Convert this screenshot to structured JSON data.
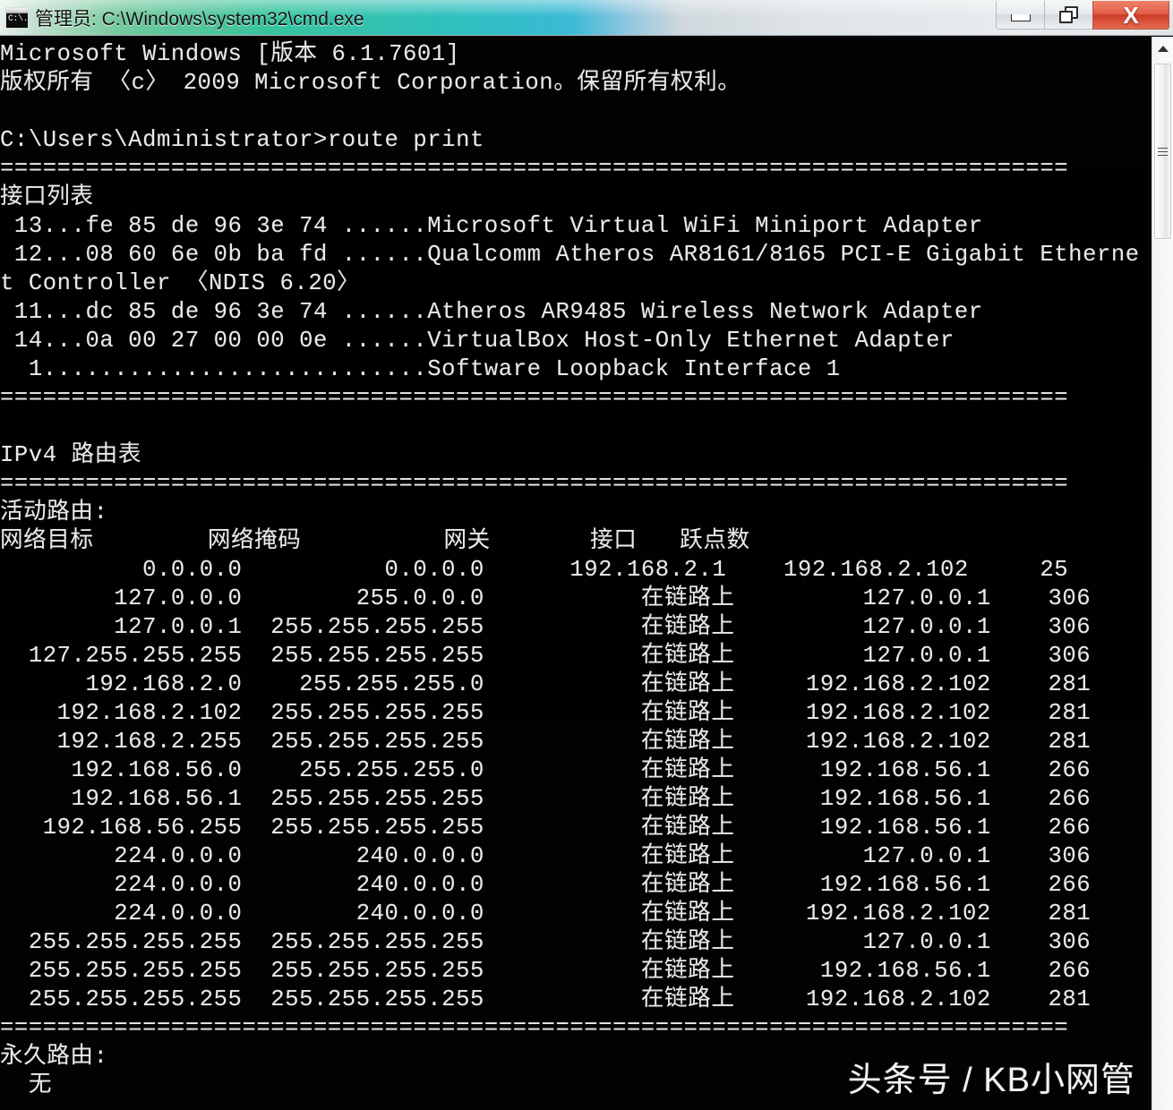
{
  "window": {
    "title": "管理员: C:\\Windows\\system32\\cmd.exe",
    "icon": "cmd-icon",
    "prompt_glyph": "C:\\.",
    "buttons": {
      "minimize": "最小化",
      "restore": "还原",
      "close": "X"
    }
  },
  "console": {
    "lines": [
      "Microsoft Windows [版本 6.1.7601]",
      "版权所有 〈c〉 2009 Microsoft Corporation。保留所有权利。",
      "",
      "C:\\Users\\Administrator>route print",
      "===========================================================================",
      "接口列表",
      " 13...fe 85 de 96 3e 74 ......Microsoft Virtual WiFi Miniport Adapter",
      " 12...08 60 6e 0b ba fd ......Qualcomm Atheros AR8161/8165 PCI-E Gigabit Etherne",
      "t Controller 〈NDIS 6.20〉",
      " 11...dc 85 de 96 3e 74 ......Atheros AR9485 Wireless Network Adapter",
      " 14...0a 00 27 00 00 0e ......VirtualBox Host-Only Ethernet Adapter",
      "  1...........................Software Loopback Interface 1",
      "===========================================================================",
      "",
      "IPv4 路由表",
      "===========================================================================",
      "活动路由:",
      "网络目标        网络掩码          网关       接口   跃点数",
      "          0.0.0.0          0.0.0.0      192.168.2.1    192.168.2.102     25",
      "        127.0.0.0        255.0.0.0           在链路上         127.0.0.1    306",
      "        127.0.0.1  255.255.255.255           在链路上         127.0.0.1    306",
      "  127.255.255.255  255.255.255.255           在链路上         127.0.0.1    306",
      "      192.168.2.0    255.255.255.0           在链路上     192.168.2.102    281",
      "    192.168.2.102  255.255.255.255           在链路上     192.168.2.102    281",
      "    192.168.2.255  255.255.255.255           在链路上     192.168.2.102    281",
      "     192.168.56.0    255.255.255.0           在链路上      192.168.56.1    266",
      "     192.168.56.1  255.255.255.255           在链路上      192.168.56.1    266",
      "   192.168.56.255  255.255.255.255           在链路上      192.168.56.1    266",
      "        224.0.0.0        240.0.0.0           在链路上         127.0.0.1    306",
      "        224.0.0.0        240.0.0.0           在链路上      192.168.56.1    266",
      "        224.0.0.0        240.0.0.0           在链路上     192.168.2.102    281",
      "  255.255.255.255  255.255.255.255           在链路上         127.0.0.1    306",
      "  255.255.255.255  255.255.255.255           在链路上      192.168.56.1    266",
      "  255.255.255.255  255.255.255.255           在链路上     192.168.2.102    281",
      "===========================================================================",
      "永久路由:",
      "  无"
    ],
    "command": "route print",
    "prompt": "C:\\Users\\Administrator>",
    "os_version_line": "Microsoft Windows [版本 6.1.7601]",
    "copyright_line": "版权所有 〈c〉 2009 Microsoft Corporation。保留所有权利。",
    "interface_list_heading": "接口列表",
    "ipv4_table_heading": "IPv4 路由表",
    "active_routes_heading": "活动路由:",
    "persistent_routes_heading": "永久路由:",
    "persistent_routes_value": "无",
    "separator": "===========================================================================",
    "columns": [
      "网络目标",
      "网络掩码",
      "网关",
      "接口",
      "跃点数"
    ],
    "on_link_label": "在链路上",
    "interfaces": [
      {
        "index": "13",
        "mac": "fe 85 de 96 3e 74",
        "name": "Microsoft Virtual WiFi Miniport Adapter"
      },
      {
        "index": "12",
        "mac": "08 60 6e 0b ba fd",
        "name": "Qualcomm Atheros AR8161/8165 PCI-E Gigabit Ethernet Controller 〈NDIS 6.20〉"
      },
      {
        "index": "11",
        "mac": "dc 85 de 96 3e 74",
        "name": "Atheros AR9485 Wireless Network Adapter"
      },
      {
        "index": "14",
        "mac": "0a 00 27 00 00 0e",
        "name": "VirtualBox Host-Only Ethernet Adapter"
      },
      {
        "index": "1",
        "mac": "",
        "name": "Software Loopback Interface 1"
      }
    ],
    "routes": [
      {
        "destination": "0.0.0.0",
        "netmask": "0.0.0.0",
        "gateway": "192.168.2.1",
        "interface": "192.168.2.102",
        "metric": "25"
      },
      {
        "destination": "127.0.0.0",
        "netmask": "255.0.0.0",
        "gateway": "在链路上",
        "interface": "127.0.0.1",
        "metric": "306"
      },
      {
        "destination": "127.0.0.1",
        "netmask": "255.255.255.255",
        "gateway": "在链路上",
        "interface": "127.0.0.1",
        "metric": "306"
      },
      {
        "destination": "127.255.255.255",
        "netmask": "255.255.255.255",
        "gateway": "在链路上",
        "interface": "127.0.0.1",
        "metric": "306"
      },
      {
        "destination": "192.168.2.0",
        "netmask": "255.255.255.0",
        "gateway": "在链路上",
        "interface": "192.168.2.102",
        "metric": "281"
      },
      {
        "destination": "192.168.2.102",
        "netmask": "255.255.255.255",
        "gateway": "在链路上",
        "interface": "192.168.2.102",
        "metric": "281"
      },
      {
        "destination": "192.168.2.255",
        "netmask": "255.255.255.255",
        "gateway": "在链路上",
        "interface": "192.168.2.102",
        "metric": "281"
      },
      {
        "destination": "192.168.56.0",
        "netmask": "255.255.255.0",
        "gateway": "在链路上",
        "interface": "192.168.56.1",
        "metric": "266"
      },
      {
        "destination": "192.168.56.1",
        "netmask": "255.255.255.255",
        "gateway": "在链路上",
        "interface": "192.168.56.1",
        "metric": "266"
      },
      {
        "destination": "192.168.56.255",
        "netmask": "255.255.255.255",
        "gateway": "在链路上",
        "interface": "192.168.56.1",
        "metric": "266"
      },
      {
        "destination": "224.0.0.0",
        "netmask": "240.0.0.0",
        "gateway": "在链路上",
        "interface": "127.0.0.1",
        "metric": "306"
      },
      {
        "destination": "224.0.0.0",
        "netmask": "240.0.0.0",
        "gateway": "在链路上",
        "interface": "192.168.56.1",
        "metric": "266"
      },
      {
        "destination": "224.0.0.0",
        "netmask": "240.0.0.0",
        "gateway": "在链路上",
        "interface": "192.168.2.102",
        "metric": "281"
      },
      {
        "destination": "255.255.255.255",
        "netmask": "255.255.255.255",
        "gateway": "在链路上",
        "interface": "127.0.0.1",
        "metric": "306"
      },
      {
        "destination": "255.255.255.255",
        "netmask": "255.255.255.255",
        "gateway": "在链路上",
        "interface": "192.168.56.1",
        "metric": "266"
      },
      {
        "destination": "255.255.255.255",
        "netmask": "255.255.255.255",
        "gateway": "在链路上",
        "interface": "192.168.2.102",
        "metric": "281"
      }
    ]
  },
  "scrollbar": {
    "up_arrow": "scroll-up",
    "thumb": "scroll-thumb"
  },
  "watermark": {
    "text": "头条号 / KB小网管"
  },
  "colors": {
    "console_bg": "#000000",
    "console_fg": "#e9e9e9",
    "titlebar_accent": "#2dbfc0",
    "close_button": "#cc3d28"
  }
}
